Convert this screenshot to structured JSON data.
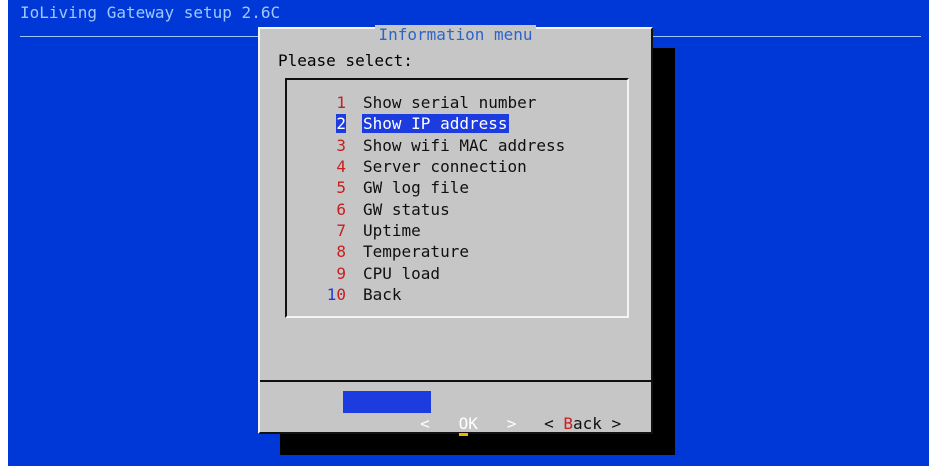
{
  "app": {
    "backtitle": "IoLiving Gateway setup 2.6C"
  },
  "dialog": {
    "title": "Information menu",
    "prompt": "Please select:"
  },
  "menu": {
    "items": [
      {
        "tag": "1",
        "label": "Show serial number"
      },
      {
        "tag": "2",
        "label": "Show IP address"
      },
      {
        "tag": "3",
        "label": "Show wifi MAC address"
      },
      {
        "tag": "4",
        "label": "Server connection"
      },
      {
        "tag": "5",
        "label": "GW log file"
      },
      {
        "tag": "6",
        "label": "GW status"
      },
      {
        "tag": "7",
        "label": "Uptime"
      },
      {
        "tag": "8",
        "label": "Temperature"
      },
      {
        "tag": "9",
        "label": "CPU load"
      },
      {
        "tag": "10",
        "label": "Back"
      }
    ],
    "selected_tag": "2"
  },
  "buttons": {
    "ok": {
      "left_arrow": "<",
      "hotkey": "O",
      "rest": "K",
      "right_arrow": ">"
    },
    "back": {
      "left_arrow": "<",
      "hotkey": "B",
      "rest": "ack",
      "right_arrow": ">"
    }
  },
  "colors": {
    "screen_background": "#0038d8",
    "dialog_background": "#c6c6c6",
    "selection": "#1c3ce0",
    "tag_text": "#c81e1e",
    "title_text": "#2e64c8",
    "hotkey_underline": "#f0b400"
  }
}
